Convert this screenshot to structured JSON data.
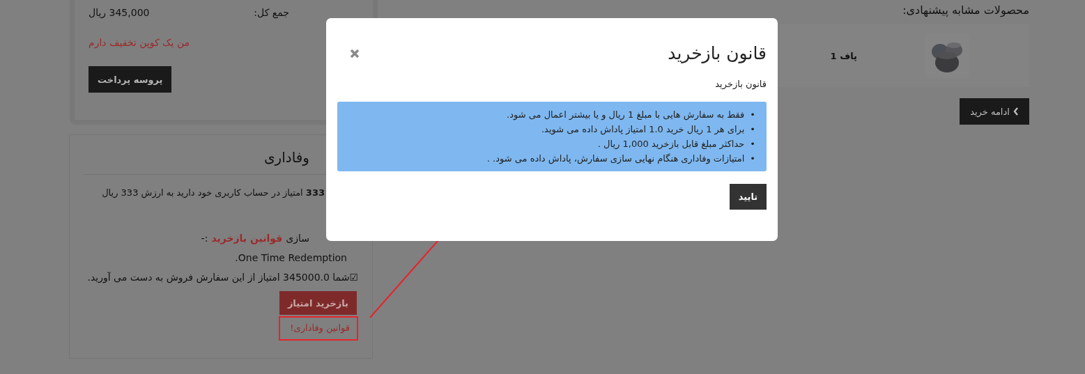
{
  "cart_totals": {
    "total_label": "جمع کل:",
    "total_value": "345,000 ریال",
    "coupon_link": "من یک کوپن تخفیف دارم",
    "checkout_button": "پروسه پرداخت"
  },
  "loyalty": {
    "title": "وفاداری",
    "points_text": "**333** امتیاز در حساب کاربری خود دارید به ارزش 333 ریال",
    "rules_prefix": "سازی",
    "rules_link": "قوانین بازخرید",
    "rules_suffix": ":-",
    "redemption_note": "One Time Redemption.",
    "earn_text": "☑شما 345000.0 امتیاز از این سفارش فروش به دست می آورید.",
    "redeem_button": "بازخرید امتیاز",
    "loyalty_rules_link": "قوانین وفاداری!"
  },
  "similar_products": {
    "title": "محصولات مشابه پیشنهادی:",
    "items": [
      {
        "name": "پاف 1"
      }
    ],
    "continue_button": "ادامه خرید"
  },
  "modal": {
    "title": "قانون بازخرید",
    "subtitle": "قانون بازخرید",
    "rules": [
      {
        "bullet": "•",
        "text": "فقط به سفارش هایی با مبلغ 1 ریال و یا بیشتر اعمال می شود."
      },
      {
        "bullet": "•",
        "text": "برای هر 1 ریال خرید 1.0 امتیاز پاداش داده می شوید."
      },
      {
        "bullet": "•",
        "text": "حداکثر مبلغ قابل بازخرید 1,000 ریال ."
      },
      {
        "bullet": "•",
        "text": "امتیازات وفاداری هنگام نهایی سازی سفارش، پاداش داده می شود. ."
      }
    ],
    "confirm_button": "تایید"
  }
}
